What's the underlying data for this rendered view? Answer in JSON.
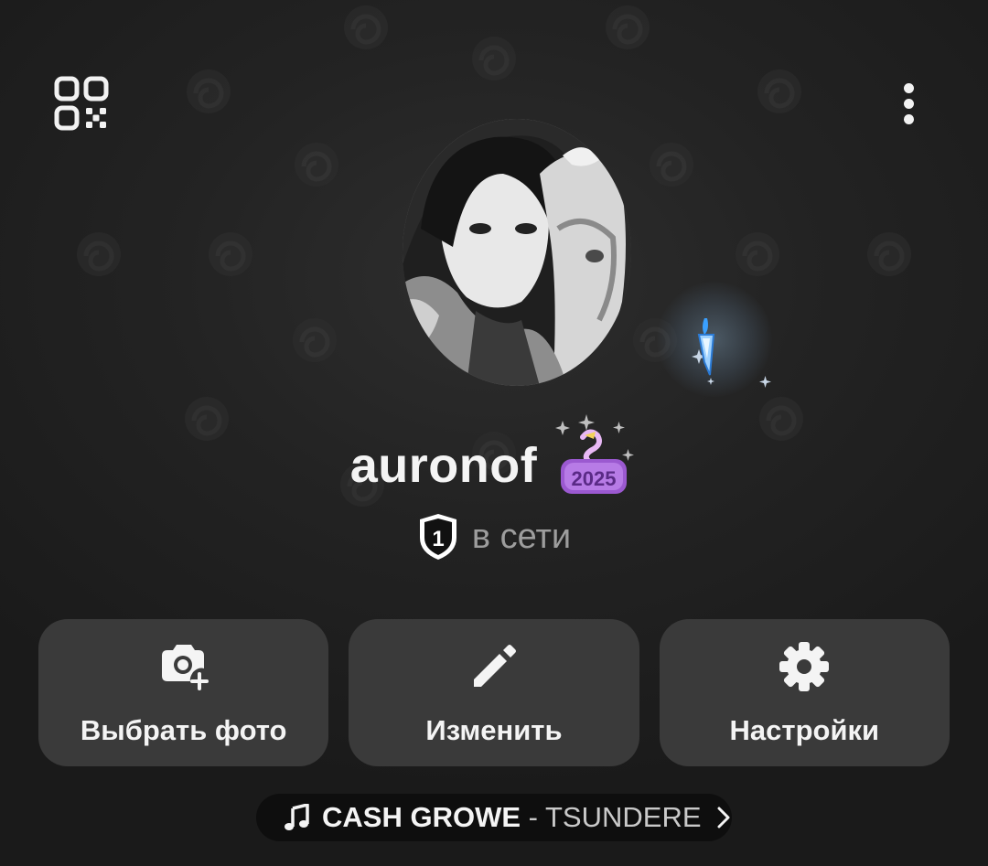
{
  "header": {
    "qr_icon": "qr-code-icon",
    "menu_icon": "more-vertical-icon"
  },
  "profile": {
    "username": "auronof",
    "badge_emoji": "2025",
    "level": "1",
    "status": "в сети"
  },
  "actions": [
    {
      "label": "Выбрать фото",
      "icon": "camera-add-icon"
    },
    {
      "label": "Изменить",
      "icon": "pencil-icon"
    },
    {
      "label": "Настройки",
      "icon": "gear-icon"
    }
  ],
  "music": {
    "artist": "CASH GROWE",
    "separator": " - ",
    "track": "TSUNDERE",
    "icon": "music-note-icon"
  },
  "colors": {
    "background": "#232323",
    "button_bg": "#3a3a3a",
    "music_bg": "#0e0e0e",
    "status_text": "#9d9d9d",
    "badge_purple": "#9b59d0"
  }
}
